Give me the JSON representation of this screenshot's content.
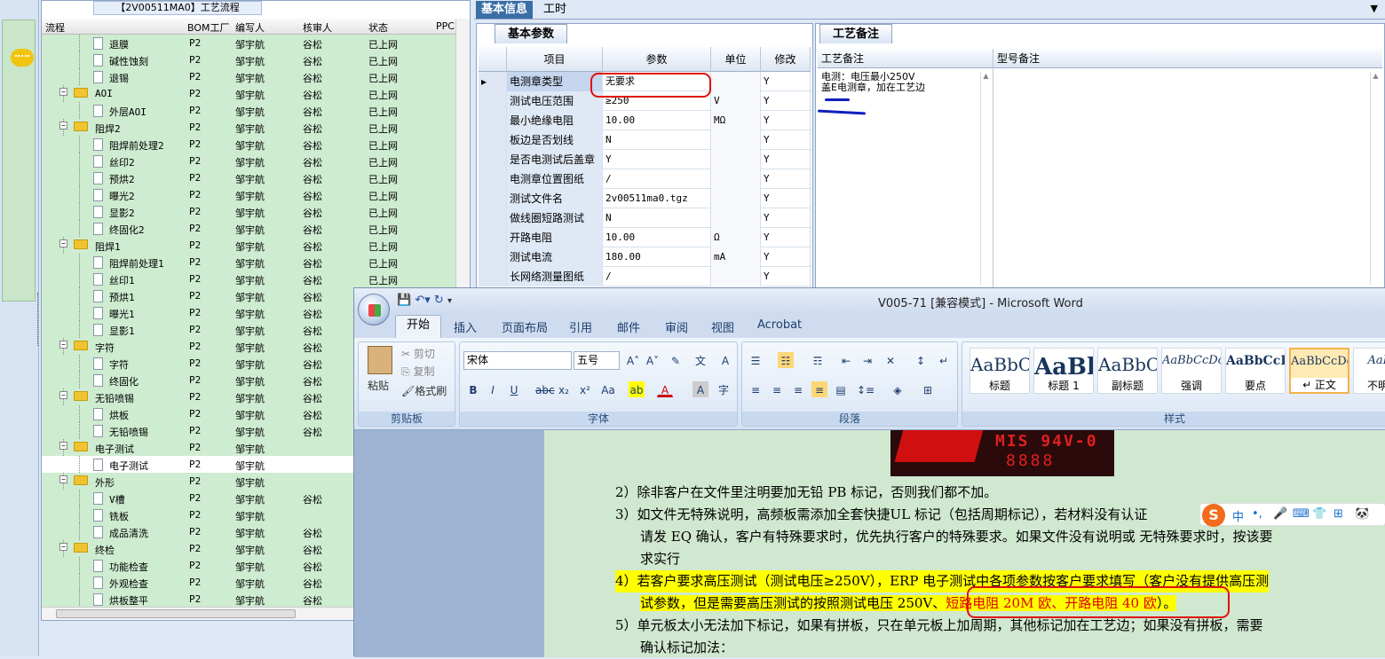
{
  "tree": {
    "title": "【2V00511MA0】工艺流程",
    "headers": [
      "流程",
      "BOM工厂",
      "编写人",
      "核审人",
      "状态",
      "PPC"
    ],
    "rows": [
      {
        "level": 2,
        "name": "退膜",
        "plant": "P2",
        "writer": "邹宇航",
        "reviewer": "谷松",
        "status": "已上网"
      },
      {
        "level": 2,
        "name": "碱性蚀刻",
        "plant": "P2",
        "writer": "邹宇航",
        "reviewer": "谷松",
        "status": "已上网"
      },
      {
        "level": 2,
        "name": "退锡",
        "plant": "P2",
        "writer": "邹宇航",
        "reviewer": "谷松",
        "status": "已上网"
      },
      {
        "level": 1,
        "name": "AOI",
        "plant": "P2",
        "writer": "邹宇航",
        "reviewer": "谷松",
        "status": "已上网"
      },
      {
        "level": 2,
        "name": "外层AOI",
        "plant": "P2",
        "writer": "邹宇航",
        "reviewer": "谷松",
        "status": "已上网"
      },
      {
        "level": 1,
        "name": "阻焊2",
        "plant": "P2",
        "writer": "邹宇航",
        "reviewer": "谷松",
        "status": "已上网"
      },
      {
        "level": 2,
        "name": "阻焊前处理2",
        "plant": "P2",
        "writer": "邹宇航",
        "reviewer": "谷松",
        "status": "已上网"
      },
      {
        "level": 2,
        "name": "丝印2",
        "plant": "P2",
        "writer": "邹宇航",
        "reviewer": "谷松",
        "status": "已上网"
      },
      {
        "level": 2,
        "name": "预烘2",
        "plant": "P2",
        "writer": "邹宇航",
        "reviewer": "谷松",
        "status": "已上网"
      },
      {
        "level": 2,
        "name": "曝光2",
        "plant": "P2",
        "writer": "邹宇航",
        "reviewer": "谷松",
        "status": "已上网"
      },
      {
        "level": 2,
        "name": "显影2",
        "plant": "P2",
        "writer": "邹宇航",
        "reviewer": "谷松",
        "status": "已上网"
      },
      {
        "level": 2,
        "name": "终固化2",
        "plant": "P2",
        "writer": "邹宇航",
        "reviewer": "谷松",
        "status": "已上网"
      },
      {
        "level": 1,
        "name": "阻焊1",
        "plant": "P2",
        "writer": "邹宇航",
        "reviewer": "谷松",
        "status": "已上网"
      },
      {
        "level": 2,
        "name": "阻焊前处理1",
        "plant": "P2",
        "writer": "邹宇航",
        "reviewer": "谷松",
        "status": "已上网"
      },
      {
        "level": 2,
        "name": "丝印1",
        "plant": "P2",
        "writer": "邹宇航",
        "reviewer": "谷松",
        "status": "已上网"
      },
      {
        "level": 2,
        "name": "预烘1",
        "plant": "P2",
        "writer": "邹宇航",
        "reviewer": "谷松",
        "status": ""
      },
      {
        "level": 2,
        "name": "曝光1",
        "plant": "P2",
        "writer": "邹宇航",
        "reviewer": "谷松",
        "status": ""
      },
      {
        "level": 2,
        "name": "显影1",
        "plant": "P2",
        "writer": "邹宇航",
        "reviewer": "谷松",
        "status": ""
      },
      {
        "level": 1,
        "name": "字符",
        "plant": "P2",
        "writer": "邹宇航",
        "reviewer": "谷松",
        "status": ""
      },
      {
        "level": 2,
        "name": "字符",
        "plant": "P2",
        "writer": "邹宇航",
        "reviewer": "谷松",
        "status": ""
      },
      {
        "level": 2,
        "name": "终固化",
        "plant": "P2",
        "writer": "邹宇航",
        "reviewer": "谷松",
        "status": ""
      },
      {
        "level": 1,
        "name": "无铅喷锡",
        "plant": "P2",
        "writer": "邹宇航",
        "reviewer": "谷松",
        "status": ""
      },
      {
        "level": 2,
        "name": "烘板",
        "plant": "P2",
        "writer": "邹宇航",
        "reviewer": "谷松",
        "status": ""
      },
      {
        "level": 2,
        "name": "无铅喷锡",
        "plant": "P2",
        "writer": "邹宇航",
        "reviewer": "谷松",
        "status": ""
      },
      {
        "level": 1,
        "name": "电子测试",
        "plant": "P2",
        "writer": "邹宇航",
        "reviewer": "",
        "status": ""
      },
      {
        "level": 2,
        "name": "电子测试",
        "plant": "P2",
        "writer": "邹宇航",
        "reviewer": "",
        "status": "",
        "selected": true
      },
      {
        "level": 1,
        "name": "外形",
        "plant": "P2",
        "writer": "邹宇航",
        "reviewer": "",
        "status": ""
      },
      {
        "level": 2,
        "name": "V槽",
        "plant": "P2",
        "writer": "邹宇航",
        "reviewer": "谷松",
        "status": ""
      },
      {
        "level": 2,
        "name": "铣板",
        "plant": "P2",
        "writer": "邹宇航",
        "reviewer": "",
        "status": ""
      },
      {
        "level": 2,
        "name": "成品清洗",
        "plant": "P2",
        "writer": "邹宇航",
        "reviewer": "谷松",
        "status": ""
      },
      {
        "level": 1,
        "name": "终检",
        "plant": "P2",
        "writer": "邹宇航",
        "reviewer": "谷松",
        "status": ""
      },
      {
        "level": 2,
        "name": "功能检查",
        "plant": "P2",
        "writer": "邹宇航",
        "reviewer": "谷松",
        "status": ""
      },
      {
        "level": 2,
        "name": "外观检查",
        "plant": "P2",
        "writer": "邹宇航",
        "reviewer": "谷松",
        "status": ""
      },
      {
        "level": 2,
        "name": "烘板整平",
        "plant": "P2",
        "writer": "邹宇航",
        "reviewer": "谷松",
        "status": ""
      }
    ]
  },
  "top_tabs": [
    "基本信息",
    "工时"
  ],
  "basic_params": {
    "tab": "基本参数",
    "headers": [
      "项目",
      "参数",
      "单位",
      "修改"
    ],
    "rows": [
      {
        "item": "电测章类型",
        "value": "无要求",
        "unit": "",
        "mod": "Y"
      },
      {
        "item": "测试电压范围",
        "value": "≥250",
        "unit": "V",
        "mod": "Y"
      },
      {
        "item": "最小绝缘电阻",
        "value": "10.00",
        "unit": "MΩ",
        "mod": "Y"
      },
      {
        "item": "板边是否划线",
        "value": "N",
        "unit": "",
        "mod": "Y"
      },
      {
        "item": "是否电测试后盖章",
        "value": "Y",
        "unit": "",
        "mod": "Y"
      },
      {
        "item": "电测章位置图纸",
        "value": "/",
        "unit": "",
        "mod": "Y"
      },
      {
        "item": "测试文件名",
        "value": "2v00511ma0.tgz",
        "unit": "",
        "mod": "Y"
      },
      {
        "item": "做线圈短路测试",
        "value": "N",
        "unit": "",
        "mod": "Y"
      },
      {
        "item": "开路电阻",
        "value": "10.00",
        "unit": "Ω",
        "mod": "Y"
      },
      {
        "item": "测试电流",
        "value": "180.00",
        "unit": "mA",
        "mod": "Y"
      },
      {
        "item": "长网络测量图纸",
        "value": "/",
        "unit": "",
        "mod": "Y"
      }
    ]
  },
  "process_notes": {
    "tab": "工艺备注",
    "col1_header": "工艺备注",
    "col2_header": "型号备注",
    "line1": "电测：电压最小250V",
    "line2": "盖E电测章，加在工艺边"
  },
  "word": {
    "title": "V005-71 [兼容模式] - Microsoft Word",
    "tabs": [
      "开始",
      "插入",
      "页面布局",
      "引用",
      "邮件",
      "审阅",
      "视图",
      "Acrobat"
    ],
    "clipboard": {
      "paste": "粘贴",
      "cut": "剪切",
      "copy": "复制",
      "format_painter": "格式刷",
      "label": "剪贴板"
    },
    "font": {
      "name": "宋体",
      "size": "五号",
      "label": "字体"
    },
    "paragraph_label": "段落",
    "styles_label": "样式",
    "styles": [
      {
        "sample": "AaBbC",
        "name": "标题"
      },
      {
        "sample": "AaBl",
        "name": "标题 1"
      },
      {
        "sample": "AaBbC",
        "name": "副标题"
      },
      {
        "sample": "AaBbCcDc",
        "name": "强调"
      },
      {
        "sample": "AaBbCcD",
        "name": "要点"
      },
      {
        "sample": "AaBbCcDc",
        "name": "↵ 正文"
      },
      {
        "sample": "AaBb",
        "name": "不明显"
      }
    ],
    "logo_text1": "MIS 94V-0",
    "logo_text2": "8888",
    "p2": "2）除非客户在文件里注明要加无铅 PB 标记，否则我们都不加。",
    "p3a": "3）如文件无特殊说明，高频板需添加全套快捷UL 标记（包括周期标记），若材料没有认证",
    "p3b": "请发 EQ 确认，客户有特殊要求时，优先执行客户的特殊要求。如果文件没有说明或 无特殊要求时，按该要",
    "p3c": "求实行",
    "p4a": "4）若客户要求高压测试（测试电压≥250V），ERP 电子测试中各项参数按客户要求填写（客户没有提供高压测",
    "p4b_pre": "试参数，但是需要高压测试的按照测试电压 250V、",
    "p4b_red": "短路电阻 20M 欧、开路电阻 40 欧",
    "p4b_post": "）。",
    "p5a": "5）单元板太小无法加下标记，如果有拼板，只在单元板上加周期，其他标记加在工艺边；如果没有拼板，需要",
    "p5b": "确认标记加法："
  },
  "ime": {
    "logo": "S",
    "items": [
      "中",
      "•,",
      "🎤",
      "⌨",
      "👕",
      "⊞",
      "🐼"
    ]
  }
}
